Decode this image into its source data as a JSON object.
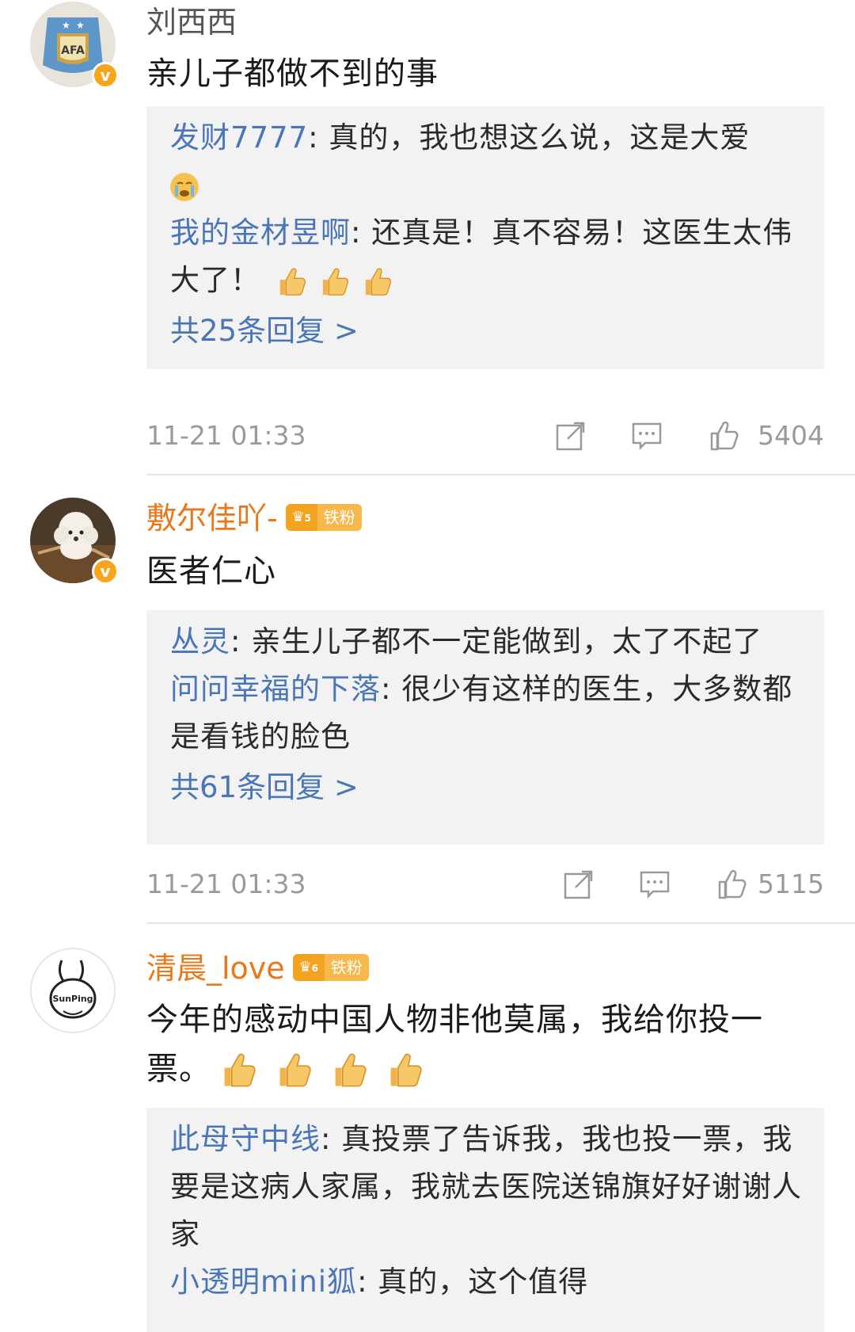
{
  "colors": {
    "link": "#4a76b8",
    "username_fan": "#e8781a",
    "badge": "#f3a31f",
    "reply_bg": "#f2f2f2"
  },
  "comments": [
    {
      "avatar_icon": "afa-jersey-avatar",
      "username": "刘西西",
      "text": "亲儿子都做不到的事",
      "replies": [
        {
          "user": "发财7777",
          "sep": ": ",
          "text": "真的，我也想这么说，这是大爱",
          "emoji": "crying-face"
        },
        {
          "user": "我的金材昱啊",
          "sep": ": ",
          "text": "还真是！真不容易！这医生太伟大了！",
          "emoji": "thumbs-up x3"
        }
      ],
      "more": "共25条回复 >",
      "time": "11-21 01:33",
      "likes": "5404"
    },
    {
      "avatar_icon": "poodle-dog-avatar",
      "username": "敷尔佳吖-",
      "fan_level": "5",
      "fan_label": "铁粉",
      "text": "医者仁心",
      "replies": [
        {
          "user": "丛灵",
          "sep": ": ",
          "text": "亲生儿子都不一定能做到，太了不起了"
        },
        {
          "user": "问问幸福的下落",
          "sep": ": ",
          "text": "很少有这样的医生，大多数都是看钱的脸色"
        }
      ],
      "more": "共61条回复 >",
      "time": "11-21 01:33",
      "likes": "5115"
    },
    {
      "avatar_icon": "sunping-rabbit-avatar",
      "avatar_text": "SunPing",
      "username": "清晨_love",
      "fan_level": "6",
      "fan_label": "铁粉",
      "text": "今年的感动中国人物非他莫属，我给你投一票。",
      "emoji": "thumbs-up x4",
      "replies": [
        {
          "user": "此母守中线",
          "sep": ": ",
          "text": "真投票了告诉我，我也投一票，我要是这病人家属，我就去医院送锦旗好好谢谢人家"
        },
        {
          "user": "小透明mini狐",
          "sep": ": ",
          "text": "真的，这个值得"
        }
      ]
    }
  ]
}
